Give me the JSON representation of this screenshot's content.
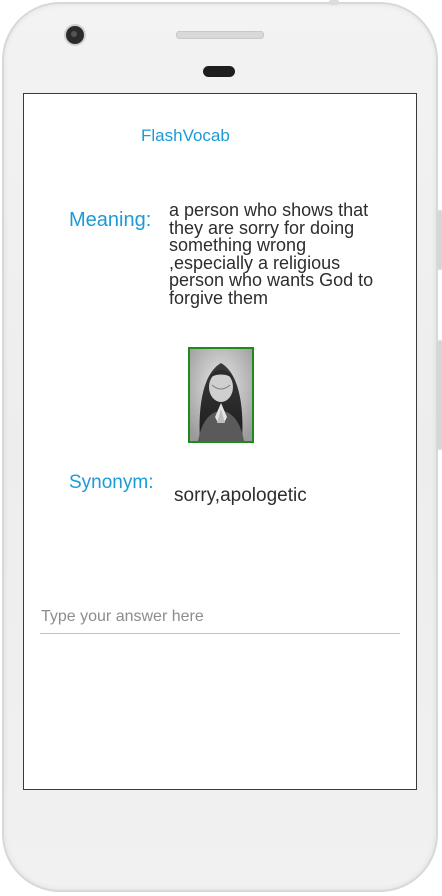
{
  "app": {
    "title": "FlashVocab"
  },
  "card": {
    "meaning_label": "Meaning:",
    "meaning_text": "a person who shows that they are sorry for doing something wrong ,especially a religious person who wants God to forgive them",
    "image_icon": "praying-girl-photo",
    "synonym_label": "Synonym:",
    "synonym_text": "sorry,apologetic"
  },
  "answer": {
    "placeholder": "Type your answer here",
    "value": ""
  },
  "colors": {
    "accent": "#1a9bd7",
    "text": "#2d2d2d",
    "image_border": "#1d8a1d"
  }
}
